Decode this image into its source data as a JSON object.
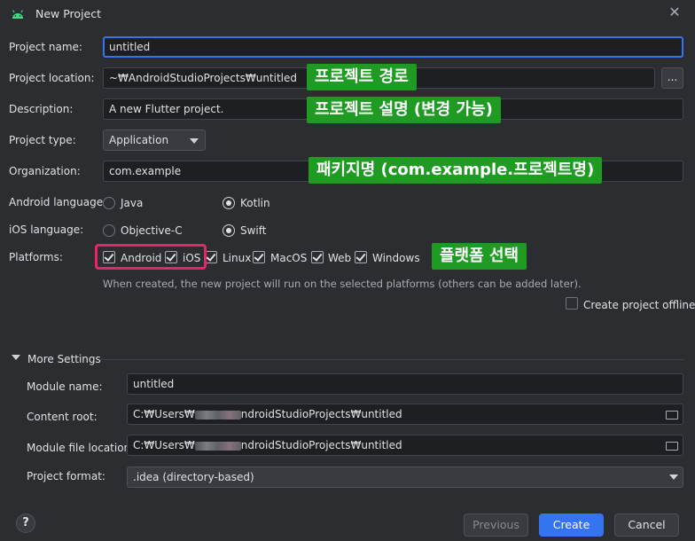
{
  "window": {
    "title": "New Project",
    "icon": "android-icon",
    "close_icon": "close-icon"
  },
  "form": {
    "project_name": {
      "label": "Project name:",
      "value": "untitled"
    },
    "project_location": {
      "label": "Project location:",
      "value": "~₩AndroidStudioProjects₩untitled",
      "browse_label": "..."
    },
    "description": {
      "label": "Description:",
      "value": "A new Flutter project."
    },
    "project_type": {
      "label": "Project type:",
      "value": "Application"
    },
    "organization": {
      "label": "Organization:",
      "value": "com.example"
    },
    "android_language": {
      "label": "Android language:",
      "options": [
        "Java",
        "Kotlin"
      ],
      "selected": "Kotlin"
    },
    "ios_language": {
      "label": "iOS language:",
      "options": [
        "Objective-C",
        "Swift"
      ],
      "selected": "Swift"
    },
    "platforms": {
      "label": "Platforms:",
      "items": [
        {
          "label": "Android",
          "checked": true
        },
        {
          "label": "iOS",
          "checked": true
        },
        {
          "label": "Linux",
          "checked": true
        },
        {
          "label": "MacOS",
          "checked": true
        },
        {
          "label": "Web",
          "checked": true
        },
        {
          "label": "Windows",
          "checked": true
        }
      ],
      "hint": "When created, the new project will run on the selected platforms (others can be added later)."
    },
    "create_offline": {
      "label": "Create project offline",
      "checked": false
    }
  },
  "more_settings": {
    "header": "More Settings",
    "module_name": {
      "label": "Module name:",
      "value": "untitled"
    },
    "content_root": {
      "label": "Content root:",
      "value_prefix": "C:₩Users₩",
      "value_suffix": "ndroidStudioProjects₩untitled",
      "icon": "folder-icon"
    },
    "module_file_location": {
      "label": "Module file location:",
      "value_prefix": "C:₩Users₩",
      "value_suffix": "ndroidStudioProjects₩untitled",
      "icon": "folder-icon"
    },
    "project_format": {
      "label": "Project format:",
      "value": ".idea (directory-based)"
    }
  },
  "annotations": {
    "project_location": "프로젝트 경로",
    "description": "프로젝트 설명 (변경 가능)",
    "organization": "패키지명 (com.example.프로젝트명)",
    "platforms": "플랫폼 선택",
    "box_color": "#e8246b",
    "label_color": "#1f9b24"
  },
  "footer": {
    "help_label": "?",
    "previous_label": "Previous",
    "create_label": "Create",
    "cancel_label": "Cancel"
  },
  "colors": {
    "accent": "#3574f0",
    "background": "#2b2d30",
    "field": "#1e1f22"
  }
}
